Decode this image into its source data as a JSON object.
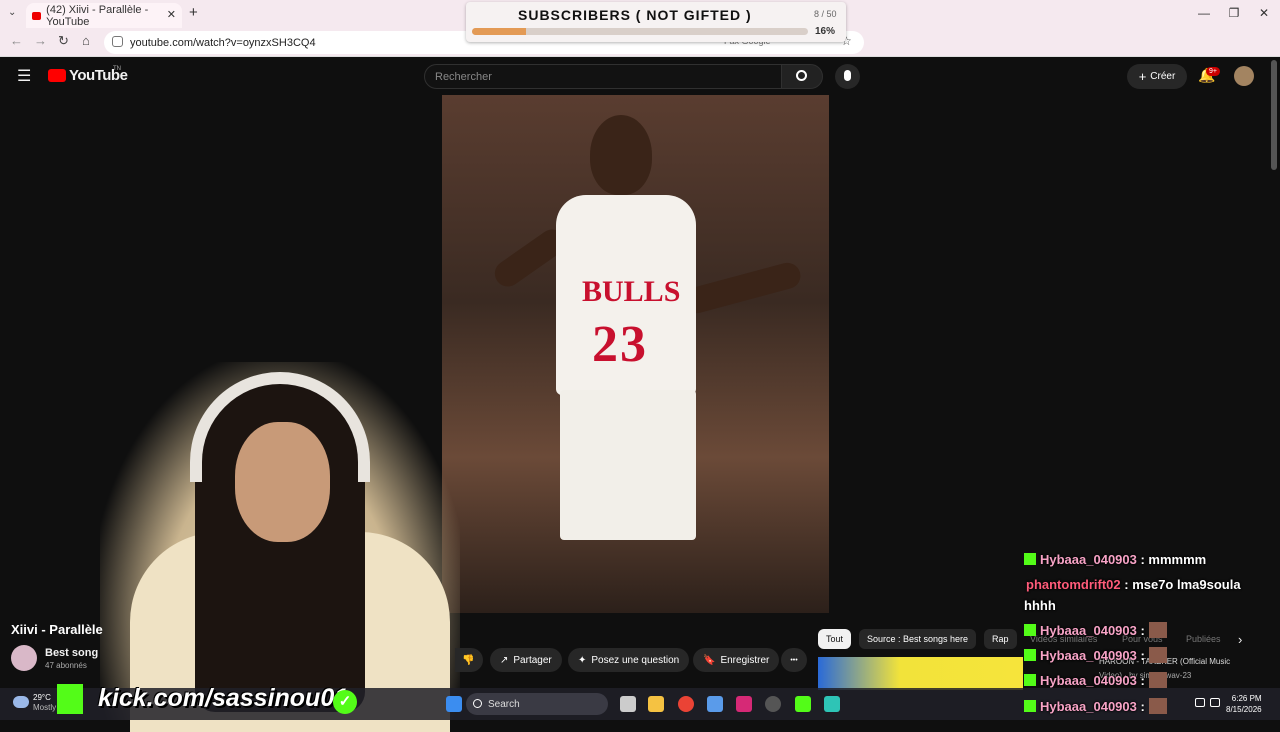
{
  "browser": {
    "tab_title": "(42) Xiivi - Parallèle - YouTube",
    "new_tab": "+",
    "url": "youtube.com/watch?v=oynzxSH3CQ4",
    "bookmark_hint": "Fax Google"
  },
  "youtube": {
    "logo": "YouTube",
    "logo_suffix": "TN",
    "search_placeholder": "Rechercher",
    "create_label": "Créer",
    "notif_badge": "9+"
  },
  "video": {
    "jersey_team": "BULLS",
    "jersey_number": "23"
  },
  "watch": {
    "title": "Xiivi - Parallèle",
    "channel": "Best song",
    "subscribers": "47 abonnés",
    "share_label": "Partager",
    "ask_label": "Posez une question",
    "save_label": "Enregistrer",
    "more_label": "•••"
  },
  "chips": [
    {
      "label": "Tout"
    },
    {
      "label": "Source : Best songs here"
    },
    {
      "label": "Rap"
    },
    {
      "label": "Vidéos similaires"
    },
    {
      "label": "Pour vous"
    },
    {
      "label": "Publiées"
    }
  ],
  "recommendation": {
    "title": "HAROON - TAKEKER (Official Music",
    "channel": "Video) · by simpe_wav-23"
  },
  "subs_goal": {
    "title": "SUBSCRIBERS ( NOT GIFTED )",
    "count": "8 / 50",
    "percent_label": "16%",
    "progress": 0.16
  },
  "chat": [
    {
      "user": "Hybaaa_040903",
      "sep": " : ",
      "msg": "mmmmm"
    },
    {
      "user": "phantomdrift02",
      "sep": " : ",
      "msg": "mse7o lma9soula"
    },
    {
      "user": "",
      "sep": "",
      "msg": "hhhh"
    },
    {
      "user": "Hybaaa_040903",
      "sep": " :",
      "msg": ""
    },
    {
      "user": "Hybaaa_040903",
      "sep": " :",
      "msg": ""
    },
    {
      "user": "Hybaaa_040903",
      "sep": " :",
      "msg": ""
    },
    {
      "user": "Hybaaa_040903",
      "sep": " :",
      "msg": ""
    }
  ],
  "overlay": {
    "kick_url": "kick.com/sassinou01",
    "verified_mark": "✓"
  },
  "taskbar": {
    "weather_temp": "29°C",
    "weather_desc": "Mostly",
    "search_label": "Search",
    "time": "6:26 PM",
    "date": "8/15/2026"
  }
}
